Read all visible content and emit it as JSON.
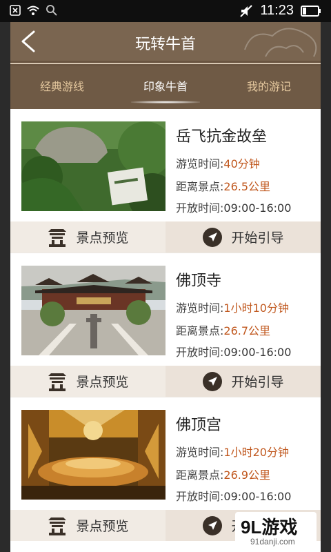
{
  "status_bar": {
    "time": "11:23",
    "icons": [
      "close-box-icon",
      "wifi-icon",
      "search-icon",
      "mute-icon",
      "battery-icon"
    ]
  },
  "header": {
    "title": "玩转牛首",
    "back_icon": "back-arrow-icon"
  },
  "tabs": [
    {
      "label": "经典游线",
      "active": false
    },
    {
      "label": "印象牛首",
      "active": true
    },
    {
      "label": "我的游记",
      "active": false
    }
  ],
  "labels": {
    "visit_time": "游览时间:",
    "distance": "距离景点:",
    "open_time": "开放时间:",
    "preview_button": "景点预览",
    "guide_button": "开始引导"
  },
  "spots": [
    {
      "name": "岳飞抗金故垒",
      "visit_time": "40分钟",
      "distance": "26.5公里",
      "open_time": "09:00-16:00",
      "image": "forest-stone-monument"
    },
    {
      "name": "佛顶寺",
      "visit_time": "1小时10分钟",
      "distance": "26.7公里",
      "open_time": "09:00-16:00",
      "image": "temple-courtyard"
    },
    {
      "name": "佛顶宫",
      "visit_time": "1小时20分钟",
      "distance": "26.9公里",
      "open_time": "09:00-16:00",
      "image": "golden-palace-interior"
    }
  ],
  "watermark": {
    "logo": "9L游戏",
    "site": "91danji.com"
  },
  "colors": {
    "header": "#7a6550",
    "tabs": "#6f5a45",
    "tab_inactive": "#e6c99f",
    "value_accent": "#c0571d"
  }
}
